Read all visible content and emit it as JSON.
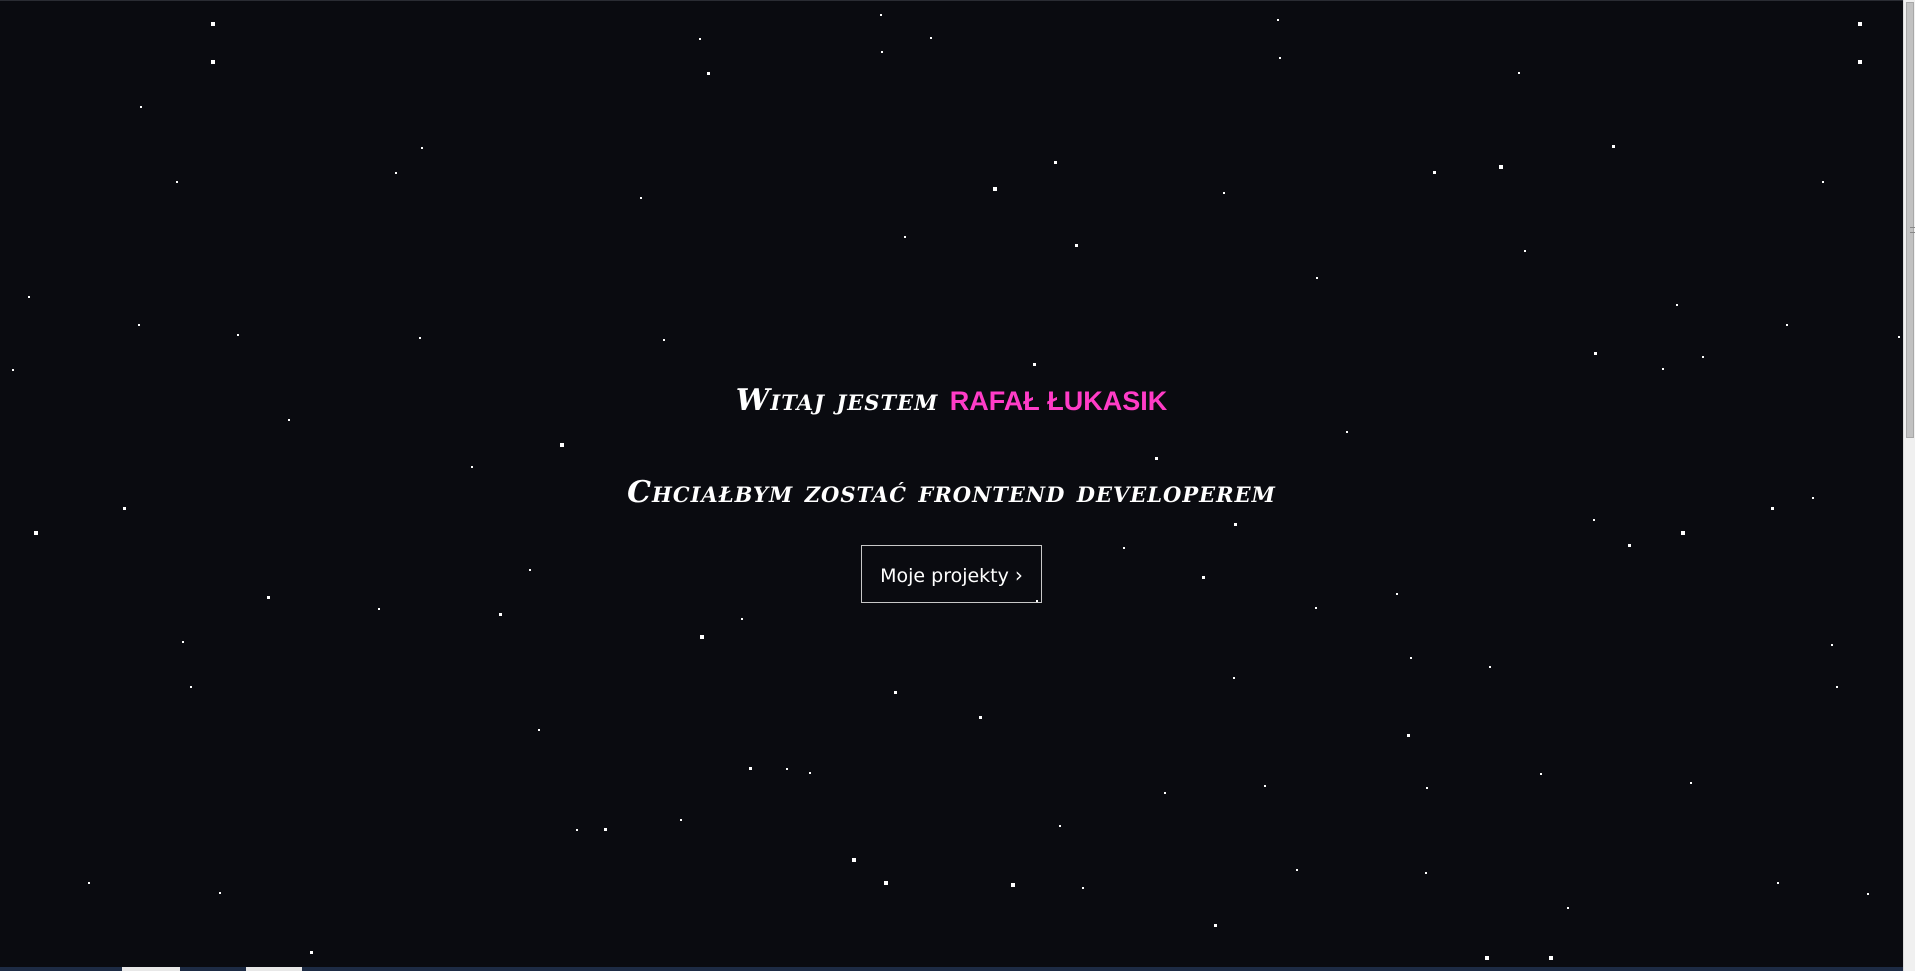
{
  "hero": {
    "greeting_prefix": "Witaj jestem",
    "name": "Rafał Łukasik",
    "tagline": "Chciałbym zostać frontend developerem",
    "button_label": "Moje projekty",
    "button_icon": "chevron-right-icon"
  },
  "colors": {
    "background": "#0a0b10",
    "text": "#ffffff",
    "accent": "#ff3cc7",
    "star": "#ffffff"
  },
  "background_decoration": "starfield"
}
